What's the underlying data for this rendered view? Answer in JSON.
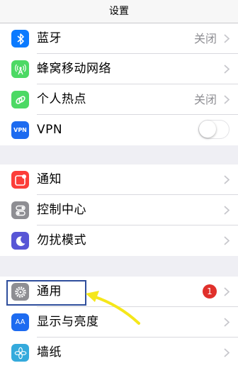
{
  "header": {
    "title": "设置"
  },
  "groups": [
    [
      {
        "key": "bluetooth",
        "label": "蓝牙",
        "value": "关闭",
        "icon": "bluetooth-icon",
        "color": "#0a7aff"
      },
      {
        "key": "cellular",
        "label": "蜂窝移动网络",
        "icon": "cellular-antenna-icon",
        "color": "#4cd964"
      },
      {
        "key": "hotspot",
        "label": "个人热点",
        "value": "关闭",
        "icon": "hotspot-link-icon",
        "color": "#4cd964"
      },
      {
        "key": "vpn",
        "label": "VPN",
        "icon": "vpn-icon",
        "icon_text": "VPN",
        "color": "#1d6bf0",
        "toggle": "off"
      }
    ],
    [
      {
        "key": "notifications",
        "label": "通知",
        "icon": "notifications-icon",
        "color": "#fc3d39"
      },
      {
        "key": "control-center",
        "label": "控制中心",
        "icon": "control-center-icon",
        "color": "#8e8e93"
      },
      {
        "key": "do-not-disturb",
        "label": "勿扰模式",
        "icon": "moon-icon",
        "color": "#5856d6"
      }
    ],
    [
      {
        "key": "general",
        "label": "通用",
        "icon": "gear-icon",
        "color": "#8e8e93",
        "badge": "1"
      },
      {
        "key": "display",
        "label": "显示与亮度",
        "icon": "text-size-icon",
        "icon_text": "AA",
        "color": "#1d6bf0"
      },
      {
        "key": "wallpaper",
        "label": "墙纸",
        "icon": "flower-icon",
        "color": "#34aadc"
      }
    ]
  ]
}
